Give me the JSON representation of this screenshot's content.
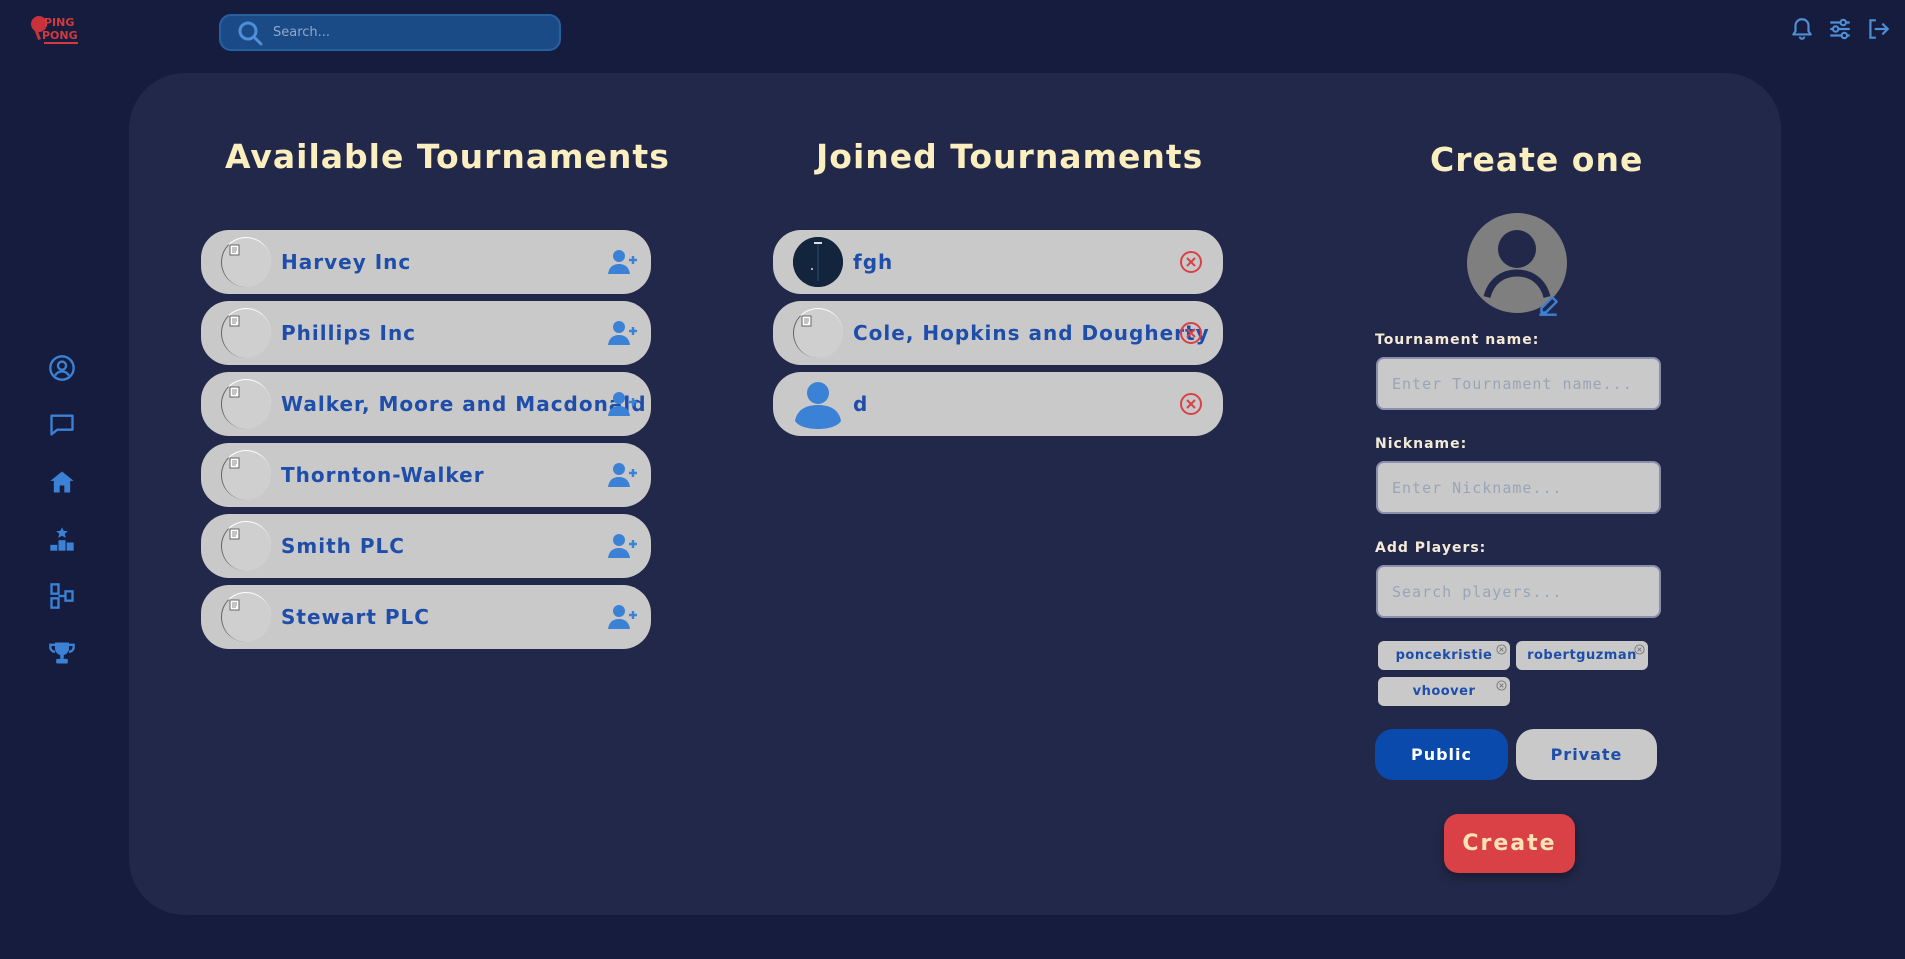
{
  "app": {
    "logo_line1": "PING",
    "logo_line2": "PONG",
    "accent": "#2e7bd6",
    "danger": "#d94147",
    "title_color": "#fbeebf"
  },
  "search": {
    "placeholder": "Search..."
  },
  "top_icons": [
    "bell-icon",
    "sliders-icon",
    "logout-icon"
  ],
  "sidebar": {
    "items": [
      "user-circle-icon",
      "chat-icon",
      "home-icon",
      "leaderboard-icon",
      "bracket-icon",
      "trophy-icon"
    ]
  },
  "available": {
    "title": "Available Tournaments",
    "items": [
      {
        "name": "Harvey Inc",
        "icon": "add-user-icon"
      },
      {
        "name": "Phillips Inc",
        "icon": "add-user-icon"
      },
      {
        "name": "Walker, Moore and Macdonald",
        "icon": "add-user-icon"
      },
      {
        "name": "Thornton-Walker",
        "icon": "add-user-icon"
      },
      {
        "name": "Smith PLC",
        "icon": "add-user-icon"
      },
      {
        "name": "Stewart PLC",
        "icon": "add-user-icon"
      }
    ]
  },
  "joined": {
    "title": "Joined Tournaments",
    "items": [
      {
        "name": "fgh",
        "thumb": "dark-image"
      },
      {
        "name": "Cole, Hopkins and Dougherty",
        "thumb": "broken-image"
      },
      {
        "name": "d",
        "thumb": "person-icon"
      }
    ]
  },
  "create": {
    "title": "Create one",
    "name_label": "Tournament name:",
    "name_placeholder": "Enter Tournament name...",
    "nickname_label": "Nickname:",
    "nickname_placeholder": "Enter Nickname...",
    "players_label": "Add Players:",
    "players_placeholder": "Search players...",
    "players": [
      "poncekristie",
      "robertguzman",
      "vhoover"
    ],
    "public_label": "Public",
    "private_label": "Private",
    "visibility_selected": "Public",
    "submit_label": "Create"
  }
}
